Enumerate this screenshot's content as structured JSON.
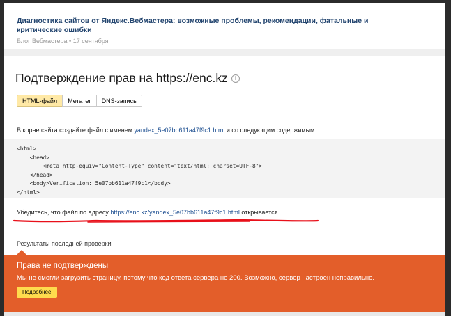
{
  "related": {
    "title": "Диагностика сайтов от Яндекс.Вебмастера: возможные проблемы, рекомендации, фатальные и критические ошибки",
    "meta": "Блог Вебмастера • 17 сентября"
  },
  "page": {
    "title": "Подтверждение прав на https://enc.kz",
    "info_icon": "i"
  },
  "tabs": [
    {
      "label": "HTML-файл",
      "active": true
    },
    {
      "label": "Метатег",
      "active": false
    },
    {
      "label": "DNS-запись",
      "active": false
    }
  ],
  "instruction": {
    "before": "В корне сайта создайте файл с именем ",
    "filename": "yandex_5e07bb611a47f9c1.html",
    "after": " и со следующим содержимым:"
  },
  "code": "<html>\n    <head>\n        <meta http-equiv=\"Content-Type\" content=\"text/html; charset=UTF-8\">\n    </head>\n    <body>Verification: 5e07bb611a47f9c1</body>\n</html>",
  "verify": {
    "before": "Убедитесь, что файл по адресу ",
    "url": "https://enc.kz/yandex_5e07bb611a47f9c1.html",
    "after": " открывается"
  },
  "results_label": "Результаты последней проверки",
  "error": {
    "title": "Права не подтверждены",
    "text": "Мы не смогли загрузить страницу, потому что код ответа сервера не 200. Возможно, сервер настроен неправильно.",
    "button": "Подробнее"
  },
  "colors": {
    "error_bg": "#e35e2a",
    "button_bg": "#ffdb4d",
    "tab_active_bg": "#ffe9a6",
    "link": "#1d4f91",
    "annotation_underline": "#e8101a"
  }
}
